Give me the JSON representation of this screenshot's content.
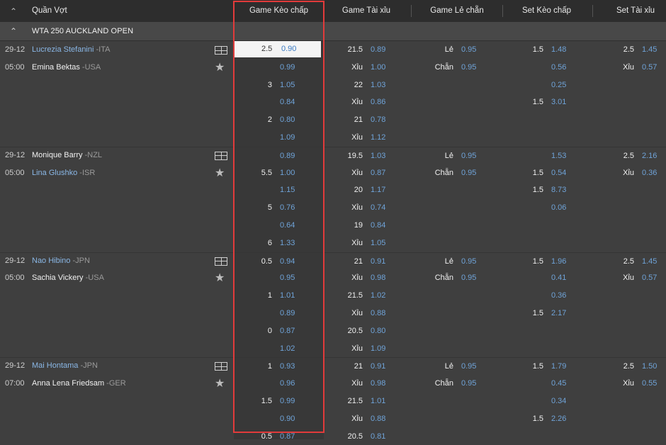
{
  "header": {
    "sport": "Quần Vợt",
    "columns": [
      "Game Kèo chấp",
      "Game Tài xỉu",
      "Game Lẻ chẵn",
      "Set Kèo chấp",
      "Set Tài xỉu"
    ]
  },
  "league": "WTA 250 AUCKLAND OPEN",
  "matches": [
    {
      "date": "29-12",
      "time": "05:00",
      "p1": "Lucrezia Stefanini",
      "p1c": " -ITA",
      "p2": "Emina Bektas",
      "p2c": " -USA"
    },
    {
      "date": "29-12",
      "time": "05:00",
      "p1": "Monique Barry",
      "p1c": " -NZL",
      "p2": "Lina Glushko",
      "p2c": " -ISR"
    },
    {
      "date": "29-12",
      "time": "05:00",
      "p1": "Nao Hibino",
      "p1c": " -JPN",
      "p2": "Sachia Vickery",
      "p2c": " -USA"
    },
    {
      "date": "29-12",
      "time": "07:00",
      "p1": "Mai Hontama",
      "p1c": " -JPN",
      "p2": "Anna Lena Friedsam",
      "p2c": " -GER"
    }
  ],
  "rows": [
    {
      "gh": "2.5",
      "go": "0.90",
      "tl": "21.5",
      "to": "0.89",
      "ll": "Lẻ",
      "lo": "0.95",
      "sh": "1.5",
      "so": "1.48",
      "stl": "2.5",
      "sto": "1.45"
    },
    {
      "gh": "",
      "go": "0.99",
      "tl": "Xỉu",
      "to": "1.00",
      "ll": "Chẵn",
      "lo": "0.95",
      "sh": "",
      "so": "0.56",
      "stl": "Xỉu",
      "sto": "0.57"
    },
    {
      "gh": "3",
      "go": "1.05",
      "tl": "22",
      "to": "1.03",
      "ll": "",
      "lo": "",
      "sh": "",
      "so": "0.25",
      "stl": "",
      "sto": ""
    },
    {
      "gh": "",
      "go": "0.84",
      "tl": "Xỉu",
      "to": "0.86",
      "ll": "",
      "lo": "",
      "sh": "1.5",
      "so": "3.01",
      "stl": "",
      "sto": ""
    },
    {
      "gh": "2",
      "go": "0.80",
      "tl": "21",
      "to": "0.78",
      "ll": "",
      "lo": "",
      "sh": "",
      "so": "",
      "stl": "",
      "sto": ""
    },
    {
      "gh": "",
      "go": "1.09",
      "tl": "Xỉu",
      "to": "1.12",
      "ll": "",
      "lo": "",
      "sh": "",
      "so": "",
      "stl": "",
      "sto": ""
    },
    {
      "gh": "",
      "go": "0.89",
      "tl": "19.5",
      "to": "1.03",
      "ll": "Lẻ",
      "lo": "0.95",
      "sh": "",
      "so": "1.53",
      "stl": "2.5",
      "sto": "2.16"
    },
    {
      "gh": "5.5",
      "go": "1.00",
      "tl": "Xỉu",
      "to": "0.87",
      "ll": "Chẵn",
      "lo": "0.95",
      "sh": "1.5",
      "so": "0.54",
      "stl": "Xỉu",
      "sto": "0.36"
    },
    {
      "gh": "",
      "go": "1.15",
      "tl": "20",
      "to": "1.17",
      "ll": "",
      "lo": "",
      "sh": "1.5",
      "so": "8.73",
      "stl": "",
      "sto": ""
    },
    {
      "gh": "5",
      "go": "0.76",
      "tl": "Xỉu",
      "to": "0.74",
      "ll": "",
      "lo": "",
      "sh": "",
      "so": "0.06",
      "stl": "",
      "sto": ""
    },
    {
      "gh": "",
      "go": "0.64",
      "tl": "19",
      "to": "0.84",
      "ll": "",
      "lo": "",
      "sh": "",
      "so": "",
      "stl": "",
      "sto": ""
    },
    {
      "gh": "6",
      "go": "1.33",
      "tl": "Xỉu",
      "to": "1.05",
      "ll": "",
      "lo": "",
      "sh": "",
      "so": "",
      "stl": "",
      "sto": ""
    },
    {
      "gh": "0.5",
      "go": "0.94",
      "tl": "21",
      "to": "0.91",
      "ll": "Lẻ",
      "lo": "0.95",
      "sh": "1.5",
      "so": "1.96",
      "stl": "2.5",
      "sto": "1.45"
    },
    {
      "gh": "",
      "go": "0.95",
      "tl": "Xỉu",
      "to": "0.98",
      "ll": "Chẵn",
      "lo": "0.95",
      "sh": "",
      "so": "0.41",
      "stl": "Xỉu",
      "sto": "0.57"
    },
    {
      "gh": "1",
      "go": "1.01",
      "tl": "21.5",
      "to": "1.02",
      "ll": "",
      "lo": "",
      "sh": "",
      "so": "0.36",
      "stl": "",
      "sto": ""
    },
    {
      "gh": "",
      "go": "0.89",
      "tl": "Xỉu",
      "to": "0.88",
      "ll": "",
      "lo": "",
      "sh": "1.5",
      "so": "2.17",
      "stl": "",
      "sto": ""
    },
    {
      "gh": "0",
      "go": "0.87",
      "tl": "20.5",
      "to": "0.80",
      "ll": "",
      "lo": "",
      "sh": "",
      "so": "",
      "stl": "",
      "sto": ""
    },
    {
      "gh": "",
      "go": "1.02",
      "tl": "Xỉu",
      "to": "1.09",
      "ll": "",
      "lo": "",
      "sh": "",
      "so": "",
      "stl": "",
      "sto": ""
    },
    {
      "gh": "1",
      "go": "0.93",
      "tl": "21",
      "to": "0.91",
      "ll": "Lẻ",
      "lo": "0.95",
      "sh": "1.5",
      "so": "1.79",
      "stl": "2.5",
      "sto": "1.50"
    },
    {
      "gh": "",
      "go": "0.96",
      "tl": "Xỉu",
      "to": "0.98",
      "ll": "Chẵn",
      "lo": "0.95",
      "sh": "",
      "so": "0.45",
      "stl": "Xỉu",
      "sto": "0.55"
    },
    {
      "gh": "1.5",
      "go": "0.99",
      "tl": "21.5",
      "to": "1.01",
      "ll": "",
      "lo": "",
      "sh": "",
      "so": "0.34",
      "stl": "",
      "sto": ""
    },
    {
      "gh": "",
      "go": "0.90",
      "tl": "Xỉu",
      "to": "0.88",
      "ll": "",
      "lo": "",
      "sh": "1.5",
      "so": "2.26",
      "stl": "",
      "sto": ""
    },
    {
      "gh": "0.5",
      "go": "0.87",
      "tl": "20.5",
      "to": "0.81",
      "ll": "",
      "lo": "",
      "sh": "",
      "so": "",
      "stl": "",
      "sto": ""
    }
  ]
}
